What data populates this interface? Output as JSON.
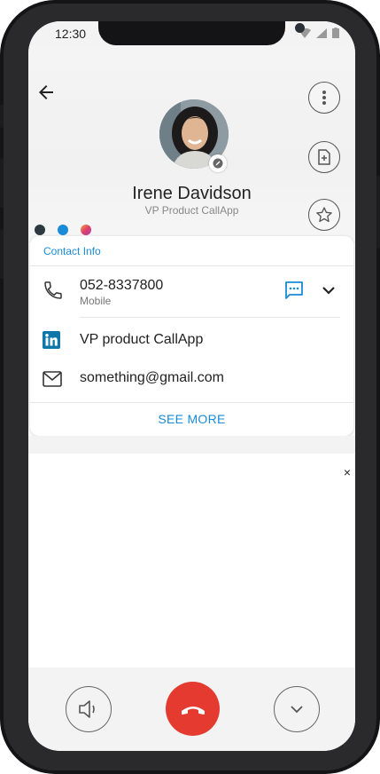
{
  "status_bar": {
    "time": "12:30"
  },
  "contact": {
    "name": "Irene Davidson",
    "title": "VP Product CallApp"
  },
  "social_dots": [
    {
      "name": "dark-dot",
      "color": "#2b3a40"
    },
    {
      "name": "blue-dot",
      "color": "#1a8bd6"
    },
    {
      "name": "instagram-dot",
      "color": "#e05a6a"
    }
  ],
  "card": {
    "title": "Contact Info",
    "phone": {
      "number": "052-8337800",
      "type": "Mobile"
    },
    "linkedin": "VP product CallApp",
    "email": "something@gmail.com",
    "see_more": "SEE MORE"
  },
  "ad": {
    "close": "×"
  },
  "colors": {
    "accent": "#1a8bd6",
    "hangup": "#e43a2f"
  },
  "icons": [
    "back-arrow-icon",
    "more-vert-icon",
    "add-note-icon",
    "star-icon",
    "edit-icon",
    "phone-icon",
    "sms-icon",
    "chevron-down-icon",
    "linkedin-icon",
    "mail-icon",
    "speaker-icon",
    "hangup-icon",
    "collapse-icon"
  ]
}
